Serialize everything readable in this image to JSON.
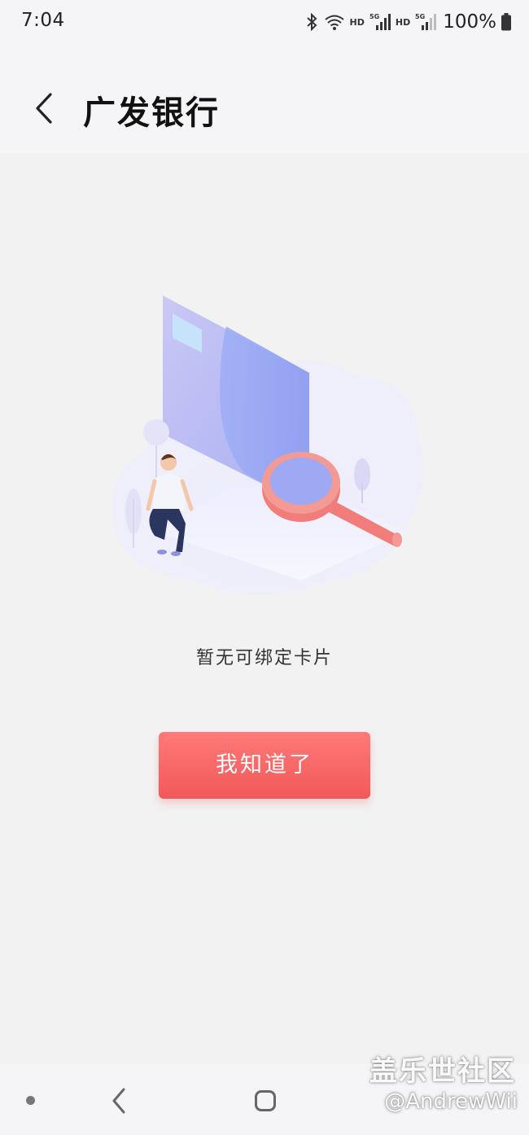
{
  "status_bar": {
    "time": "7:04",
    "hd_1": "HD",
    "hd_2": "HD",
    "signal_1_label": "5G",
    "signal_2_label": "5G",
    "battery": "100%",
    "icons": [
      "bluetooth-icon",
      "wifi-icon",
      "signal-icon",
      "signal-icon",
      "battery-icon"
    ]
  },
  "header": {
    "title": "广发银行",
    "back_icon": "chevron-left-icon"
  },
  "empty_state": {
    "illustration": "card-search-illustration",
    "message": "暂无可绑定卡片"
  },
  "actions": {
    "ack_label": "我知道了"
  },
  "navigation_bar": {
    "icons": [
      "recent-dot-icon",
      "back-icon",
      "home-icon"
    ]
  },
  "watermark": {
    "title": "盖乐世社区",
    "user": "@AndrewWii"
  },
  "colors": {
    "accent": "#f2585a",
    "background": "#f2f2f2"
  }
}
